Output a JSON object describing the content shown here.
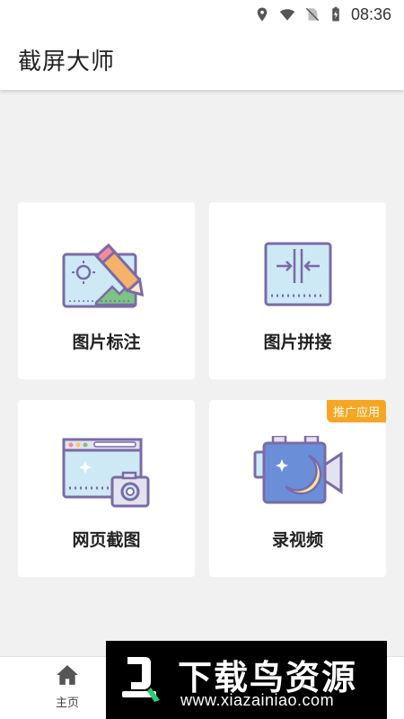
{
  "status_bar": {
    "time": "08:36",
    "icons": [
      "location-icon",
      "wifi-icon",
      "no-sim-icon",
      "battery-charging-icon"
    ]
  },
  "app_bar": {
    "title": "截屏大师"
  },
  "features": [
    {
      "label": "图片标注",
      "icon": "image-annotate-icon"
    },
    {
      "label": "图片拼接",
      "icon": "image-stitch-icon"
    },
    {
      "label": "网页截图",
      "icon": "webpage-screenshot-icon"
    },
    {
      "label": "录视频",
      "icon": "video-camera-icon",
      "badge": "推广应用"
    }
  ],
  "bottom_nav": {
    "items": [
      {
        "label": "主页",
        "icon": "home-icon",
        "active": true
      }
    ]
  },
  "watermark": {
    "title": "下载鸟资源",
    "url": "www.xiazainiao.com"
  },
  "colors": {
    "accent_purple": "#7a6aa6",
    "badge_orange": "#f5a623",
    "background": "#f1f1f1"
  }
}
